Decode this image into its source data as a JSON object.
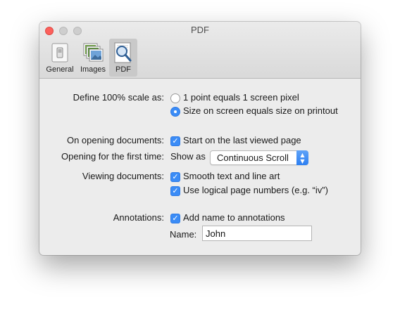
{
  "window": {
    "title": "PDF"
  },
  "toolbar": {
    "tabs": [
      {
        "label": "General",
        "icon": "general-switch-icon"
      },
      {
        "label": "Images",
        "icon": "images-icon"
      },
      {
        "label": "PDF",
        "icon": "pdf-magnifier-icon",
        "selected": true
      }
    ]
  },
  "scale": {
    "label": "Define 100% scale as:",
    "options": [
      {
        "label": "1 point equals 1 screen pixel",
        "selected": false
      },
      {
        "label": "Size on screen equals size on printout",
        "selected": true
      }
    ]
  },
  "opening": {
    "label": "On opening documents:",
    "checkbox": "Start on the last viewed page",
    "checked": true
  },
  "first_time": {
    "label": "Opening for the first time:",
    "show_as": "Show as",
    "selected_value": "Continuous Scroll"
  },
  "viewing": {
    "label": "Viewing documents:",
    "checkboxes": [
      {
        "label": "Smooth text and line art",
        "checked": true
      },
      {
        "label": "Use logical page numbers (e.g. “iv”)",
        "checked": true
      }
    ]
  },
  "annotations": {
    "label": "Annotations:",
    "checkbox": "Add name to annotations",
    "checked": true,
    "name_label": "Name:",
    "name_value": "John"
  },
  "colors": {
    "accent": "#3b8cf6",
    "close": "#fc605c",
    "window_bg": "#ececec"
  }
}
